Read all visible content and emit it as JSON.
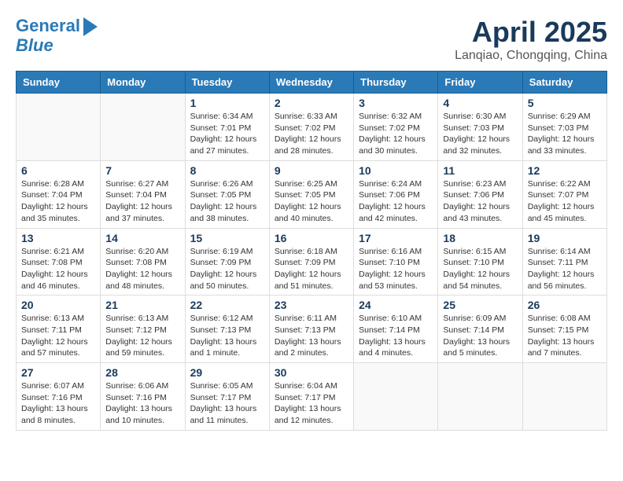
{
  "header": {
    "logo_line1": "General",
    "logo_line2": "Blue",
    "title": "April 2025",
    "subtitle": "Lanqiao, Chongqing, China"
  },
  "weekdays": [
    "Sunday",
    "Monday",
    "Tuesday",
    "Wednesday",
    "Thursday",
    "Friday",
    "Saturday"
  ],
  "weeks": [
    [
      {
        "day": "",
        "info": ""
      },
      {
        "day": "",
        "info": ""
      },
      {
        "day": "1",
        "info": "Sunrise: 6:34 AM\nSunset: 7:01 PM\nDaylight: 12 hours and 27 minutes."
      },
      {
        "day": "2",
        "info": "Sunrise: 6:33 AM\nSunset: 7:02 PM\nDaylight: 12 hours and 28 minutes."
      },
      {
        "day": "3",
        "info": "Sunrise: 6:32 AM\nSunset: 7:02 PM\nDaylight: 12 hours and 30 minutes."
      },
      {
        "day": "4",
        "info": "Sunrise: 6:30 AM\nSunset: 7:03 PM\nDaylight: 12 hours and 32 minutes."
      },
      {
        "day": "5",
        "info": "Sunrise: 6:29 AM\nSunset: 7:03 PM\nDaylight: 12 hours and 33 minutes."
      }
    ],
    [
      {
        "day": "6",
        "info": "Sunrise: 6:28 AM\nSunset: 7:04 PM\nDaylight: 12 hours and 35 minutes."
      },
      {
        "day": "7",
        "info": "Sunrise: 6:27 AM\nSunset: 7:04 PM\nDaylight: 12 hours and 37 minutes."
      },
      {
        "day": "8",
        "info": "Sunrise: 6:26 AM\nSunset: 7:05 PM\nDaylight: 12 hours and 38 minutes."
      },
      {
        "day": "9",
        "info": "Sunrise: 6:25 AM\nSunset: 7:05 PM\nDaylight: 12 hours and 40 minutes."
      },
      {
        "day": "10",
        "info": "Sunrise: 6:24 AM\nSunset: 7:06 PM\nDaylight: 12 hours and 42 minutes."
      },
      {
        "day": "11",
        "info": "Sunrise: 6:23 AM\nSunset: 7:06 PM\nDaylight: 12 hours and 43 minutes."
      },
      {
        "day": "12",
        "info": "Sunrise: 6:22 AM\nSunset: 7:07 PM\nDaylight: 12 hours and 45 minutes."
      }
    ],
    [
      {
        "day": "13",
        "info": "Sunrise: 6:21 AM\nSunset: 7:08 PM\nDaylight: 12 hours and 46 minutes."
      },
      {
        "day": "14",
        "info": "Sunrise: 6:20 AM\nSunset: 7:08 PM\nDaylight: 12 hours and 48 minutes."
      },
      {
        "day": "15",
        "info": "Sunrise: 6:19 AM\nSunset: 7:09 PM\nDaylight: 12 hours and 50 minutes."
      },
      {
        "day": "16",
        "info": "Sunrise: 6:18 AM\nSunset: 7:09 PM\nDaylight: 12 hours and 51 minutes."
      },
      {
        "day": "17",
        "info": "Sunrise: 6:16 AM\nSunset: 7:10 PM\nDaylight: 12 hours and 53 minutes."
      },
      {
        "day": "18",
        "info": "Sunrise: 6:15 AM\nSunset: 7:10 PM\nDaylight: 12 hours and 54 minutes."
      },
      {
        "day": "19",
        "info": "Sunrise: 6:14 AM\nSunset: 7:11 PM\nDaylight: 12 hours and 56 minutes."
      }
    ],
    [
      {
        "day": "20",
        "info": "Sunrise: 6:13 AM\nSunset: 7:11 PM\nDaylight: 12 hours and 57 minutes."
      },
      {
        "day": "21",
        "info": "Sunrise: 6:13 AM\nSunset: 7:12 PM\nDaylight: 12 hours and 59 minutes."
      },
      {
        "day": "22",
        "info": "Sunrise: 6:12 AM\nSunset: 7:13 PM\nDaylight: 13 hours and 1 minute."
      },
      {
        "day": "23",
        "info": "Sunrise: 6:11 AM\nSunset: 7:13 PM\nDaylight: 13 hours and 2 minutes."
      },
      {
        "day": "24",
        "info": "Sunrise: 6:10 AM\nSunset: 7:14 PM\nDaylight: 13 hours and 4 minutes."
      },
      {
        "day": "25",
        "info": "Sunrise: 6:09 AM\nSunset: 7:14 PM\nDaylight: 13 hours and 5 minutes."
      },
      {
        "day": "26",
        "info": "Sunrise: 6:08 AM\nSunset: 7:15 PM\nDaylight: 13 hours and 7 minutes."
      }
    ],
    [
      {
        "day": "27",
        "info": "Sunrise: 6:07 AM\nSunset: 7:16 PM\nDaylight: 13 hours and 8 minutes."
      },
      {
        "day": "28",
        "info": "Sunrise: 6:06 AM\nSunset: 7:16 PM\nDaylight: 13 hours and 10 minutes."
      },
      {
        "day": "29",
        "info": "Sunrise: 6:05 AM\nSunset: 7:17 PM\nDaylight: 13 hours and 11 minutes."
      },
      {
        "day": "30",
        "info": "Sunrise: 6:04 AM\nSunset: 7:17 PM\nDaylight: 13 hours and 12 minutes."
      },
      {
        "day": "",
        "info": ""
      },
      {
        "day": "",
        "info": ""
      },
      {
        "day": "",
        "info": ""
      }
    ]
  ]
}
